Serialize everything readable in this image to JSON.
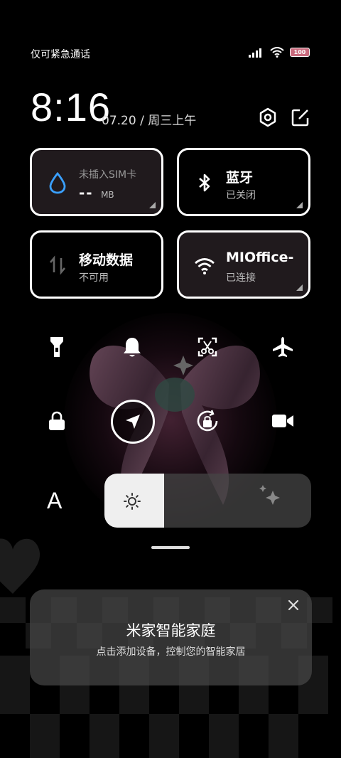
{
  "status_bar": {
    "carrier": "仅可紧急通话",
    "battery": "100"
  },
  "clock": {
    "time": "8:16",
    "date": "07.20 / 周三上午"
  },
  "tiles": [
    {
      "title": "未插入SIM卡",
      "value": "--",
      "unit": "MB",
      "icon": "water-drop-icon"
    },
    {
      "title": "蓝牙",
      "subtitle": "已关闭",
      "icon": "bluetooth-icon"
    },
    {
      "title": "移动数据",
      "subtitle": "不可用",
      "icon": "mobile-data-icon"
    },
    {
      "title": "MIOffice-",
      "subtitle": "已连接",
      "icon": "wifi-icon"
    }
  ],
  "toggles": [
    "flashlight-icon",
    "bell-icon",
    "screenshot-icon",
    "airplane-icon",
    "lock-icon",
    "location-icon",
    "auto-rotate-icon",
    "video-icon"
  ],
  "brightness": {
    "level": 0.29
  },
  "font_label": "A",
  "smart_home": {
    "title": "米家智能家庭",
    "subtitle": "点击添加设备，控制您的智能家居"
  }
}
